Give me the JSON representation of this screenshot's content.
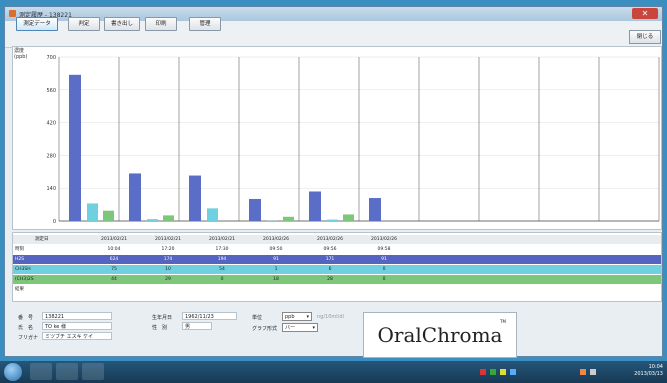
{
  "window": {
    "title": "測定履歴 - 138221",
    "close_symbol": "✕"
  },
  "toolbar": {
    "buttons": [
      {
        "label": "測定データ"
      },
      {
        "label": "判定"
      },
      {
        "label": "書き出し"
      },
      {
        "label": "印刷"
      },
      {
        "label": "管理"
      }
    ],
    "close_label": "閉じる"
  },
  "chart_data": {
    "type": "bar",
    "ylabel": "濃度 (ppb)",
    "ylim": [
      0,
      700
    ],
    "yticks": [
      0,
      140,
      280,
      420,
      560,
      700
    ],
    "slots": 10,
    "series": [
      {
        "color": "#5b6ec7",
        "values": [
          624,
          203,
          194,
          94,
          126,
          98
        ]
      },
      {
        "color": "#6fd1df",
        "values": [
          75,
          8,
          54,
          1,
          6,
          0
        ]
      },
      {
        "color": "#7cc77a",
        "values": [
          44,
          24,
          0,
          18,
          28,
          0
        ]
      }
    ]
  },
  "table": {
    "header_label": "測定日",
    "dates": [
      "2013/02/21",
      "2013/02/21",
      "2013/02/21",
      "2013/02/26",
      "2013/02/26",
      "2013/02/26"
    ],
    "rows": [
      {
        "label": "時刻",
        "color": "#ffffff",
        "values": [
          "10:04",
          "17:20",
          "17:30",
          "09:50",
          "09:56",
          "09:58"
        ]
      },
      {
        "label": "H2S",
        "color": "#5563c1",
        "values": [
          "624",
          "174",
          "194",
          "91",
          "171",
          "91"
        ]
      },
      {
        "label": "CH3SH",
        "color": "#6fd1df",
        "values": [
          "75",
          "10",
          "54",
          "1",
          "6",
          "0"
        ]
      },
      {
        "label": "(CH3)2S",
        "color": "#7cc77a",
        "values": [
          "44",
          "29",
          "0",
          "18",
          "28",
          "0"
        ]
      },
      {
        "label": "結果",
        "color": "#ffffff",
        "values": [
          "",
          "",
          "",
          "",
          "",
          ""
        ]
      }
    ]
  },
  "info": {
    "id_label": "番　号",
    "id_value": "138221",
    "name_label": "氏　名",
    "name_value": "TO ke 様",
    "kana_label": "フリガナ",
    "kana_value": "ミツブチ エスキ ケイ",
    "birth_label": "生年月日",
    "birth_value": "1962/11/23",
    "sex_label": "性　別",
    "sex_value": "男",
    "unit_label": "単位",
    "unit_value": "ppb",
    "unit_extra": "ng/10ml/dl",
    "graph_label": "グラフ形式",
    "graph_value": "バー"
  },
  "logo": {
    "text": "OralChroma",
    "tm": "TM"
  },
  "taskbar": {
    "time": "10:04",
    "date": "2013/03/13"
  }
}
